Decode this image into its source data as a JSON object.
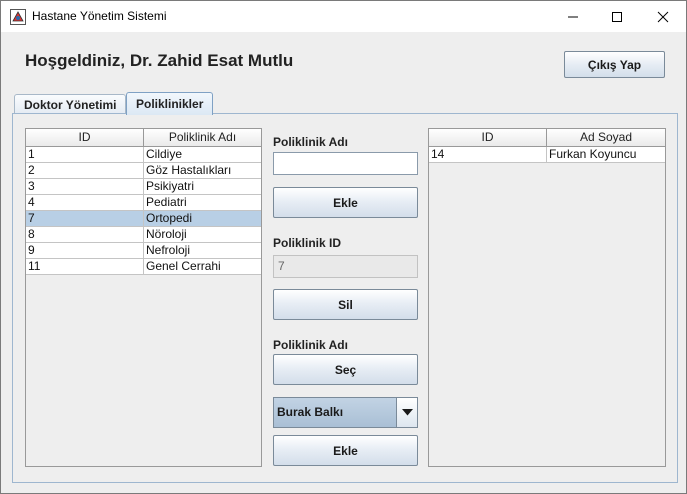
{
  "window": {
    "title": "Hastane Yönetim Sistemi"
  },
  "header": {
    "welcome": "Hoşgeldiniz, Dr. Zahid Esat Mutlu",
    "logout_label": "Çıkış Yap"
  },
  "tabs": [
    {
      "label": "Doktor Yönetimi",
      "active": false
    },
    {
      "label": "Poliklinikler",
      "active": true
    }
  ],
  "clinics_table": {
    "columns": [
      "ID",
      "Poliklinik Adı"
    ],
    "rows": [
      [
        "1",
        "Cildiye"
      ],
      [
        "2",
        "Göz Hastalıkları"
      ],
      [
        "3",
        "Psikiyatri"
      ],
      [
        "4",
        "Pediatri"
      ],
      [
        "7",
        "Ortopedi"
      ],
      [
        "8",
        "Nöroloji"
      ],
      [
        "9",
        "Nefroloji"
      ],
      [
        "11",
        "Genel Cerrahi"
      ]
    ],
    "selected_row": 4
  },
  "form": {
    "clinic_name_label": "Poliklinik Adı",
    "clinic_name_value": "",
    "add_label": "Ekle",
    "clinic_id_label": "Poliklinik ID",
    "clinic_id_value": "7",
    "delete_label": "Sil",
    "clinic_name_label2": "Poliklinik Adı",
    "select_label": "Seç",
    "doctor_select_value": "Burak Balkı",
    "add_label2": "Ekle"
  },
  "workers_table": {
    "columns": [
      "ID",
      "Ad Soyad"
    ],
    "rows": [
      [
        "14",
        "Furkan Koyuncu"
      ]
    ]
  },
  "icons": {
    "app": "hospital-app-icon",
    "minimize": "minimize-icon",
    "maximize": "maximize-icon",
    "close": "close-icon",
    "dropdown": "chevron-down-icon"
  },
  "colors": {
    "selected_row": "#b8cfe5",
    "combo_bg": "#a9bfd5",
    "tab_border": "#9eb6cf"
  }
}
